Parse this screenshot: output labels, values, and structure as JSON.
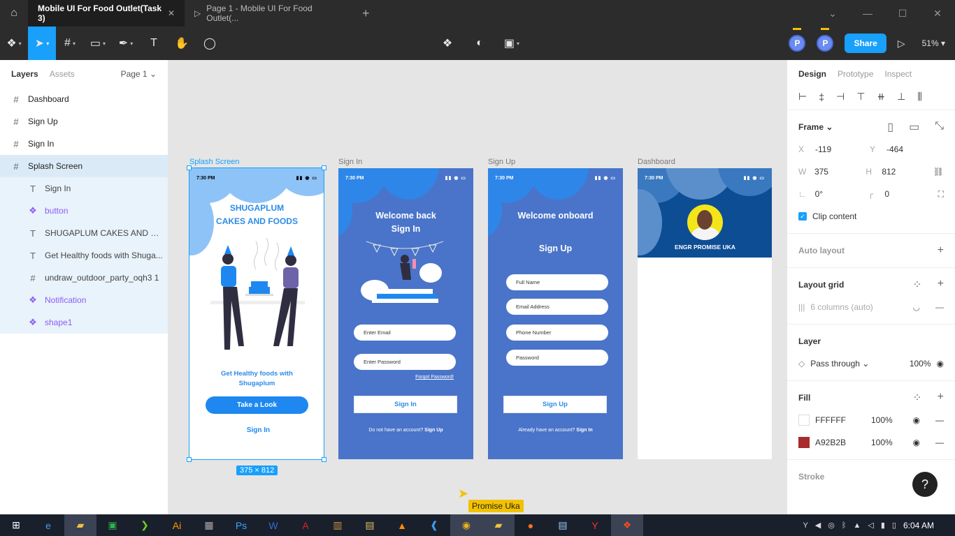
{
  "window": {
    "tabs": [
      {
        "label": "Mobile UI For Food Outlet(Task 3)",
        "active": true
      },
      {
        "label": "Page 1 - Mobile UI For Food Outlet(...",
        "active": false
      }
    ]
  },
  "toolbar": {
    "avatar1": "P",
    "avatar2": "P",
    "share_label": "Share",
    "zoom": "51%"
  },
  "left_panel": {
    "tab_layers": "Layers",
    "tab_assets": "Assets",
    "page": "Page 1",
    "layers": [
      {
        "label": "Dashboard",
        "type": "frame"
      },
      {
        "label": "Sign Up",
        "type": "frame"
      },
      {
        "label": "Sign In",
        "type": "frame"
      },
      {
        "label": "Splash Screen",
        "type": "frame",
        "selected": true
      }
    ],
    "children": [
      {
        "label": "Sign In",
        "type": "text"
      },
      {
        "label": "button",
        "type": "component"
      },
      {
        "label": "SHUGAPLUM CAKES AND FO...",
        "type": "text"
      },
      {
        "label": "Get Healthy foods with Shuga...",
        "type": "text"
      },
      {
        "label": "undraw_outdoor_party_oqh3 1",
        "type": "frame"
      },
      {
        "label": "Notification",
        "type": "component"
      },
      {
        "label": "shape1",
        "type": "component"
      }
    ]
  },
  "canvas": {
    "frames": {
      "splash": {
        "label": "Splash Screen",
        "time": "7:30 PM",
        "title_line1": "SHUGAPLUM",
        "title_line2": "CAKES AND FOODS",
        "sub_line1": "Get Healthy foods with",
        "sub_line2": "Shugaplum",
        "button": "Take a Look",
        "signin": "Sign In",
        "size": "375 × 812"
      },
      "signin": {
        "label": "Sign In",
        "time": "7:30 PM",
        "title_line1": "Welcome back",
        "title_line2": "Sign In",
        "email": "Enter Email",
        "password": "Enter Password",
        "forgot": "Forgot Password!",
        "button": "Sign In",
        "foot_text": "Do not have an account?",
        "foot_link": "Sign Up"
      },
      "signup": {
        "label": "Sign Up",
        "time": "7:30 PM",
        "title_line1": "Welcome onboard",
        "title_line2": "Sign Up",
        "full_name": "Full Name",
        "email": "Email Address",
        "phone": "Phone Number",
        "password": "Password",
        "button": "Sign Up",
        "foot_text": "Already have an account?",
        "foot_link": "Sign In"
      },
      "dashboard": {
        "label": "Dashboard",
        "time": "7:30 PM",
        "name": "ENGR PROMISE UKA"
      }
    },
    "cursor_user": "Promise Uka"
  },
  "right_panel": {
    "tab_design": "Design",
    "tab_prototype": "Prototype",
    "tab_inspect": "Inspect",
    "frame_label": "Frame",
    "x_label": "X",
    "x": "-119",
    "y_label": "Y",
    "y": "-464",
    "w_label": "W",
    "w": "375",
    "h_label": "H",
    "h": "812",
    "rotation": "0°",
    "radius": "0",
    "clip_content": "Clip content",
    "auto_layout": "Auto layout",
    "layout_grid": "Layout grid",
    "grid_value": "6 columns (auto)",
    "layer_title": "Layer",
    "blend": "Pass through",
    "layer_opacity": "100%",
    "fill_title": "Fill",
    "fills": [
      {
        "hex": "FFFFFF",
        "opacity": "100%",
        "color": "#FFFFFF"
      },
      {
        "hex": "A92B2B",
        "opacity": "100%",
        "color": "#A92B2B"
      }
    ],
    "stroke_title": "Stroke",
    "help": "?"
  },
  "taskbar": {
    "time": "6:04 AM"
  }
}
